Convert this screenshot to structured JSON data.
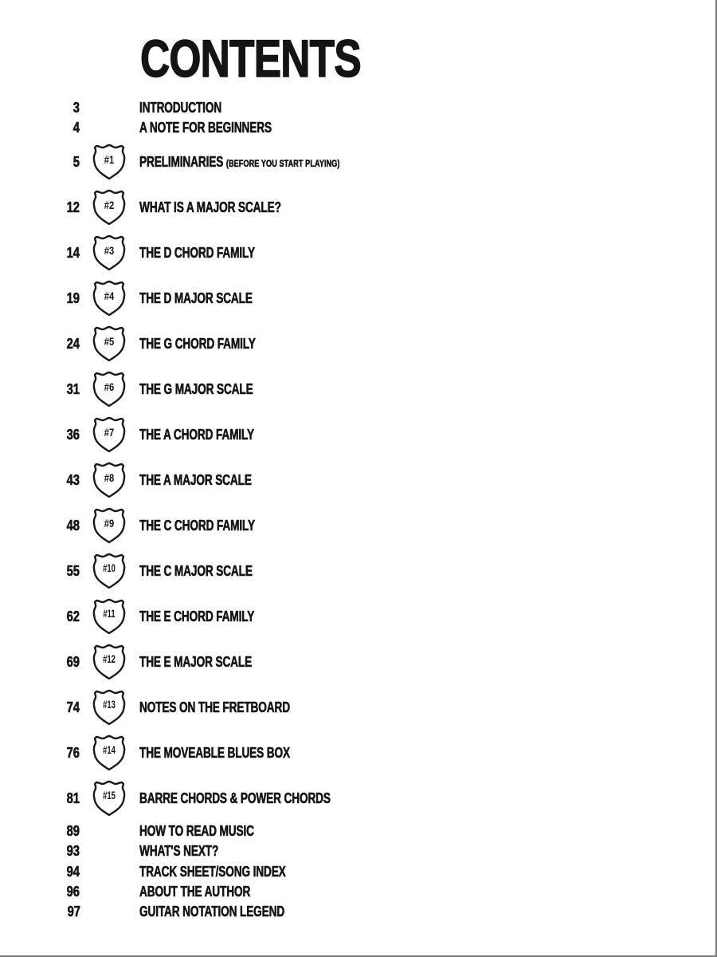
{
  "page": {
    "title": "CONTENTS"
  },
  "toc": {
    "intro_entries": [
      {
        "page": "3",
        "label": "INTRODUCTION"
      },
      {
        "page": "4",
        "label": "A NOTE FOR BEGINNERS"
      }
    ],
    "chapters": [
      {
        "page": "5",
        "badge": "#1",
        "label": "PRELIMINARIES",
        "sublabel": "(BEFORE YOU START PLAYING)"
      },
      {
        "page": "12",
        "badge": "#2",
        "label": "WHAT IS A MAJOR SCALE?"
      },
      {
        "page": "14",
        "badge": "#3",
        "label": "THE D CHORD FAMILY"
      },
      {
        "page": "19",
        "badge": "#4",
        "label": "THE D MAJOR SCALE"
      },
      {
        "page": "24",
        "badge": "#5",
        "label": "THE G CHORD FAMILY"
      },
      {
        "page": "31",
        "badge": "#6",
        "label": "THE G MAJOR SCALE"
      },
      {
        "page": "36",
        "badge": "#7",
        "label": "THE A CHORD FAMILY"
      },
      {
        "page": "43",
        "badge": "#8",
        "label": "THE A MAJOR SCALE"
      },
      {
        "page": "48",
        "badge": "#9",
        "label": "THE C CHORD FAMILY"
      },
      {
        "page": "55",
        "badge": "#10",
        "label": "THE C MAJOR SCALE"
      },
      {
        "page": "62",
        "badge": "#11",
        "label": "THE E CHORD FAMILY"
      },
      {
        "page": "69",
        "badge": "#12",
        "label": "THE E MAJOR SCALE"
      },
      {
        "page": "74",
        "badge": "#13",
        "label": "NOTES ON THE FRETBOARD"
      },
      {
        "page": "76",
        "badge": "#14",
        "label": "THE MOVEABLE BLUES BOX"
      },
      {
        "page": "81",
        "badge": "#15",
        "label": "BARRE CHORDS & POWER CHORDS"
      }
    ],
    "appendix_entries": [
      {
        "page": "89",
        "label": "HOW TO READ MUSIC"
      },
      {
        "page": "93",
        "label": "WHAT'S NEXT?"
      },
      {
        "page": "94",
        "label": "TRACK SHEET/SONG INDEX"
      },
      {
        "page": "96",
        "label": "ABOUT THE AUTHOR"
      },
      {
        "page": "97",
        "label": "GUITAR NOTATION LEGEND"
      }
    ],
    "badge_icon": "highway-shield-icon"
  },
  "colors": {
    "ink": "#151515",
    "background": "#ffffff",
    "border": "#7a7a7a"
  }
}
